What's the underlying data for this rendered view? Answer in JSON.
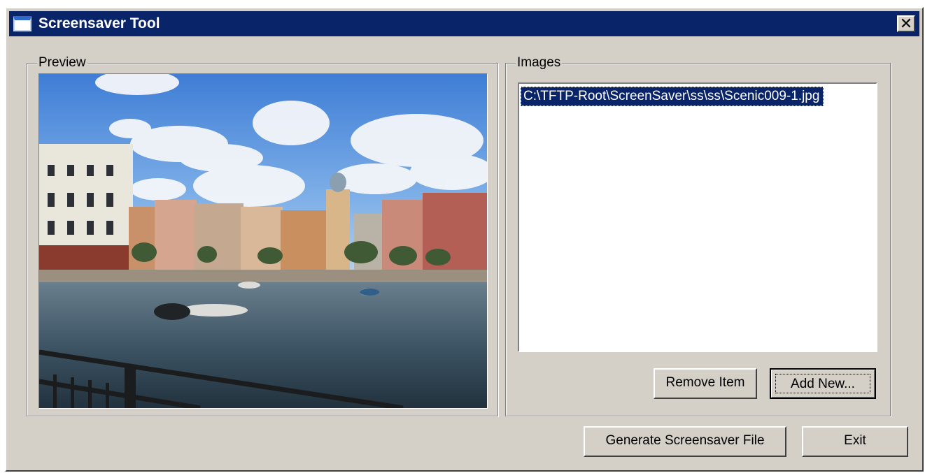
{
  "window": {
    "title": "Screensaver Tool",
    "close_symbol": "✕"
  },
  "preview": {
    "label": "Preview",
    "image_description_icon": "photo-icon"
  },
  "images": {
    "label": "Images",
    "items": [
      {
        "path": "C:\\TFTP-Root\\ScreenSaver\\ss\\ss\\Scenic009-1.jpg",
        "selected": true
      }
    ],
    "remove_label": "Remove Item",
    "add_label": "Add New..."
  },
  "footer": {
    "generate_label": "Generate Screensaver File",
    "exit_label": "Exit"
  },
  "colors": {
    "titlebar": "#0a246a",
    "face": "#d4d0c8",
    "selection": "#0a246a"
  }
}
